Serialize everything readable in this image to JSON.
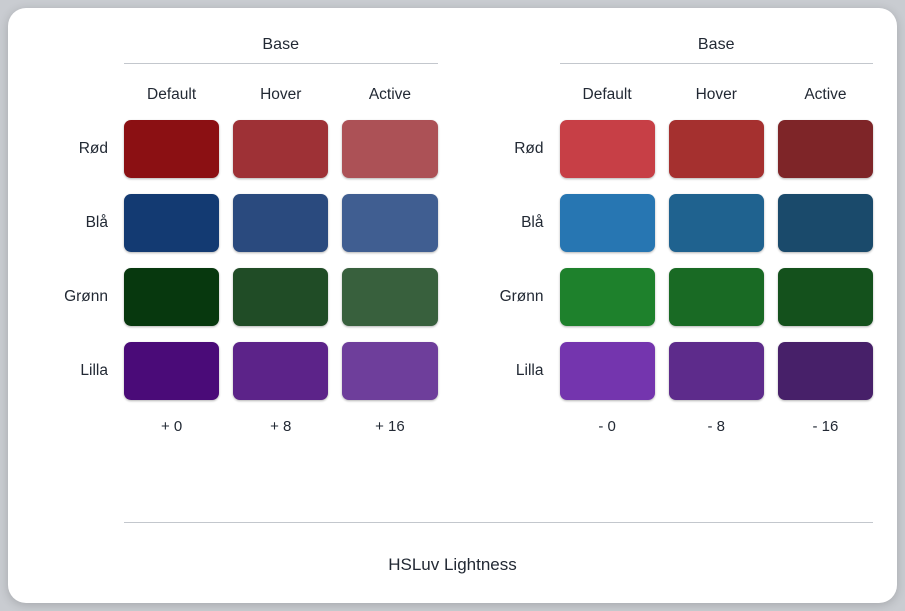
{
  "card": {
    "footer_label": "HSLuv Lightness"
  },
  "panels": [
    {
      "id": "panel-left",
      "base_title": "Base",
      "column_headers": [
        "Default",
        "Hover",
        "Active"
      ],
      "delta_labels": [
        "+ 0",
        "+ 8",
        "+ 16"
      ],
      "rows": [
        {
          "label": "Rød",
          "colors": [
            "#8B1013",
            "#9E3136",
            "#AC5156"
          ]
        },
        {
          "label": "Blå",
          "colors": [
            "#133A72",
            "#2A4A7E",
            "#405E91"
          ]
        },
        {
          "label": "Grønn",
          "colors": [
            "#07380E",
            "#204C26",
            "#38603D"
          ]
        },
        {
          "label": "Lilla",
          "colors": [
            "#4A0B78",
            "#5C2389",
            "#6E3E9B"
          ]
        }
      ]
    },
    {
      "id": "panel-right",
      "base_title": "Base",
      "column_headers": [
        "Default",
        "Hover",
        "Active"
      ],
      "delta_labels": [
        "- 0",
        "- 8",
        "- 16"
      ],
      "rows": [
        {
          "label": "Rød",
          "colors": [
            "#C73F46",
            "#A5302F",
            "#7E2528"
          ]
        },
        {
          "label": "Blå",
          "colors": [
            "#2776B2",
            "#1F628F",
            "#1A4A6B"
          ]
        },
        {
          "label": "Grønn",
          "colors": [
            "#1E812C",
            "#196A24",
            "#14511C"
          ]
        },
        {
          "label": "Lilla",
          "colors": [
            "#7435AE",
            "#5D2B8B",
            "#472069"
          ]
        }
      ]
    }
  ]
}
